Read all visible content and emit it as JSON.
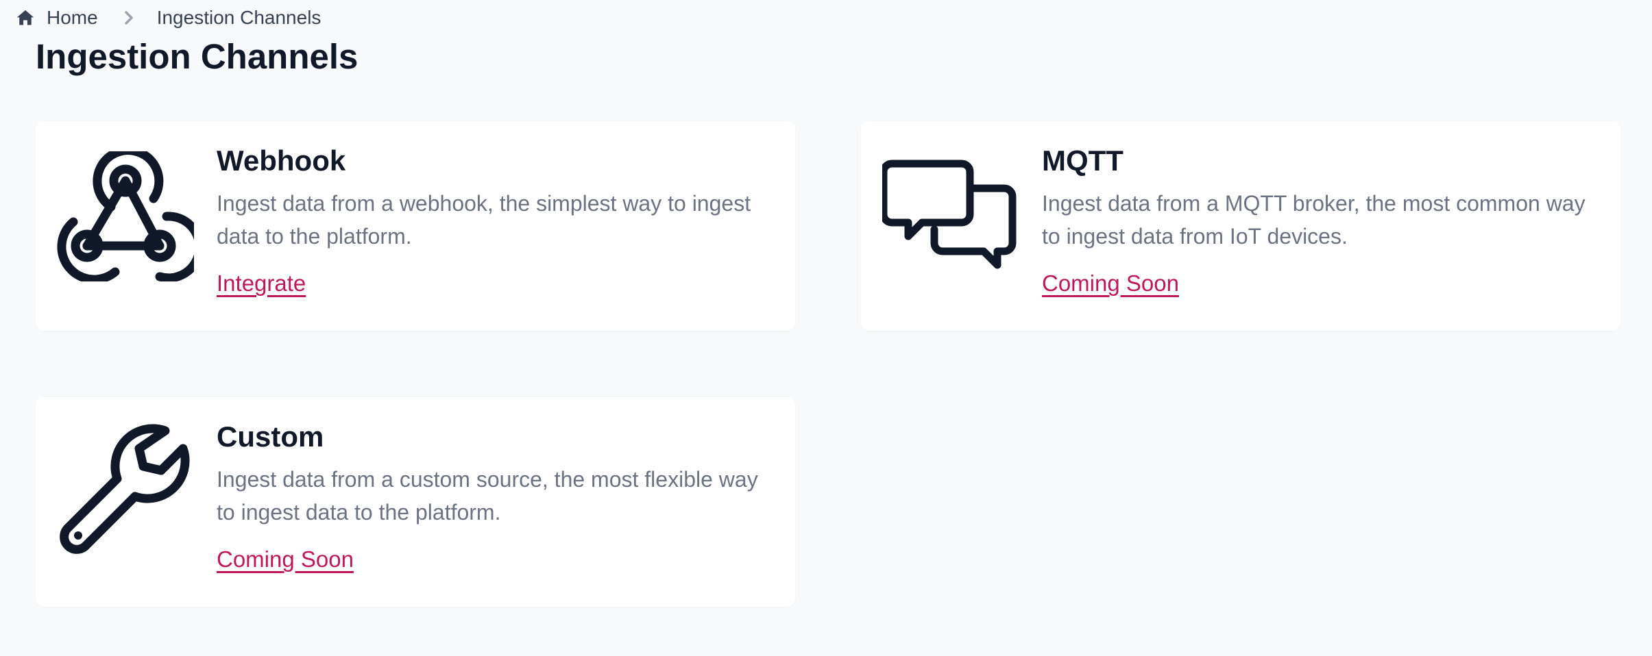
{
  "breadcrumb": {
    "home_label": "Home",
    "current_label": "Ingestion Channels",
    "home_icon": "home-icon",
    "separator_icon": "chevron-right-icon"
  },
  "page": {
    "title": "Ingestion Channels"
  },
  "channels": [
    {
      "title": "Webhook",
      "description": "Ingest data from a webhook, the simplest way to ingest data to the platform.",
      "link_label": "Integrate",
      "icon": "webhook-icon"
    },
    {
      "title": "MQTT",
      "description": "Ingest data from a MQTT broker, the most common way to ingest data from IoT devices.",
      "link_label": "Coming Soon",
      "icon": "chat-bubbles-icon"
    },
    {
      "title": "Custom",
      "description": "Ingest data from a custom source, the most flexible way to ingest data to the platform.",
      "link_label": "Coming Soon",
      "icon": "wrench-icon"
    }
  ],
  "colors": {
    "background": "#f8f9fb",
    "card": "#ffffff",
    "heading": "#111827",
    "muted": "#6b7280",
    "accent": "#be185d"
  }
}
